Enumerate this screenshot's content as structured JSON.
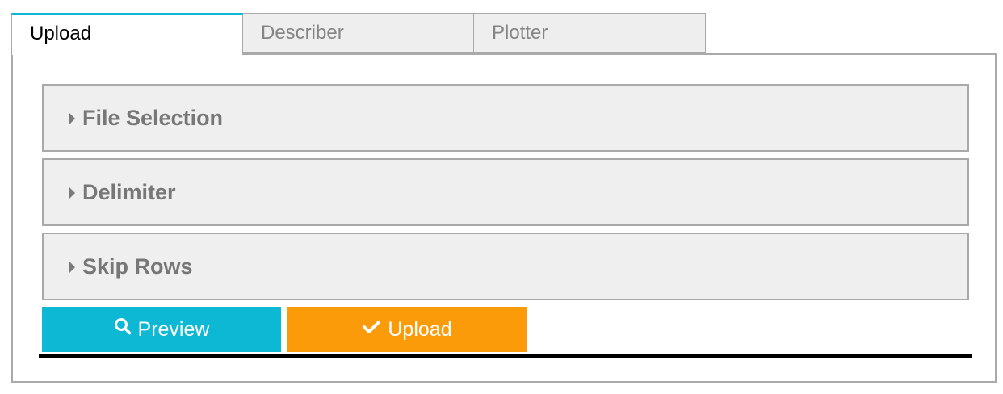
{
  "tabs": [
    {
      "label": "Upload",
      "active": true
    },
    {
      "label": "Describer",
      "active": false
    },
    {
      "label": "Plotter",
      "active": false
    }
  ],
  "accordions": [
    {
      "label": "File Selection",
      "icon": "caret-right-icon",
      "expanded": false
    },
    {
      "label": "Delimiter",
      "icon": "caret-right-icon",
      "expanded": false
    },
    {
      "label": "Skip Rows",
      "icon": "caret-right-icon",
      "expanded": false
    }
  ],
  "actions": {
    "preview": {
      "label": "Preview",
      "icon": "search-icon",
      "color": "#0cb8d4"
    },
    "upload": {
      "label": "Upload",
      "icon": "check-icon",
      "color": "#fb9b0a"
    }
  },
  "colors": {
    "active_tab_accent": "#0cb8d4",
    "tab_inactive_bg": "#eeeeee",
    "accordion_bg": "#efefef",
    "border": "#a9a9a9"
  }
}
